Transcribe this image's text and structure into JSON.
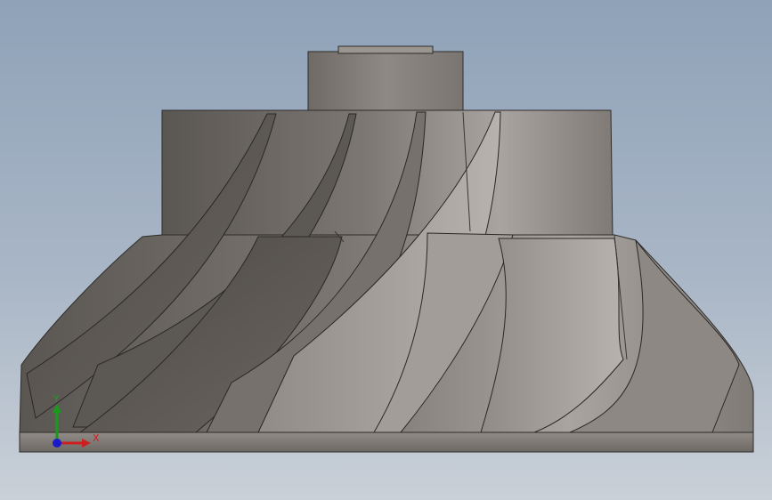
{
  "viewport": {
    "background_top": "#8fa2b8",
    "background_bottom": "#c9d0d8"
  },
  "model": {
    "name": "impeller",
    "shading_color": "#8c8680"
  },
  "triad": {
    "x_label": "X",
    "y_label": "Y",
    "x_color": "#cc2020",
    "y_color": "#1a9a1a",
    "z_color": "#1a1acc"
  }
}
